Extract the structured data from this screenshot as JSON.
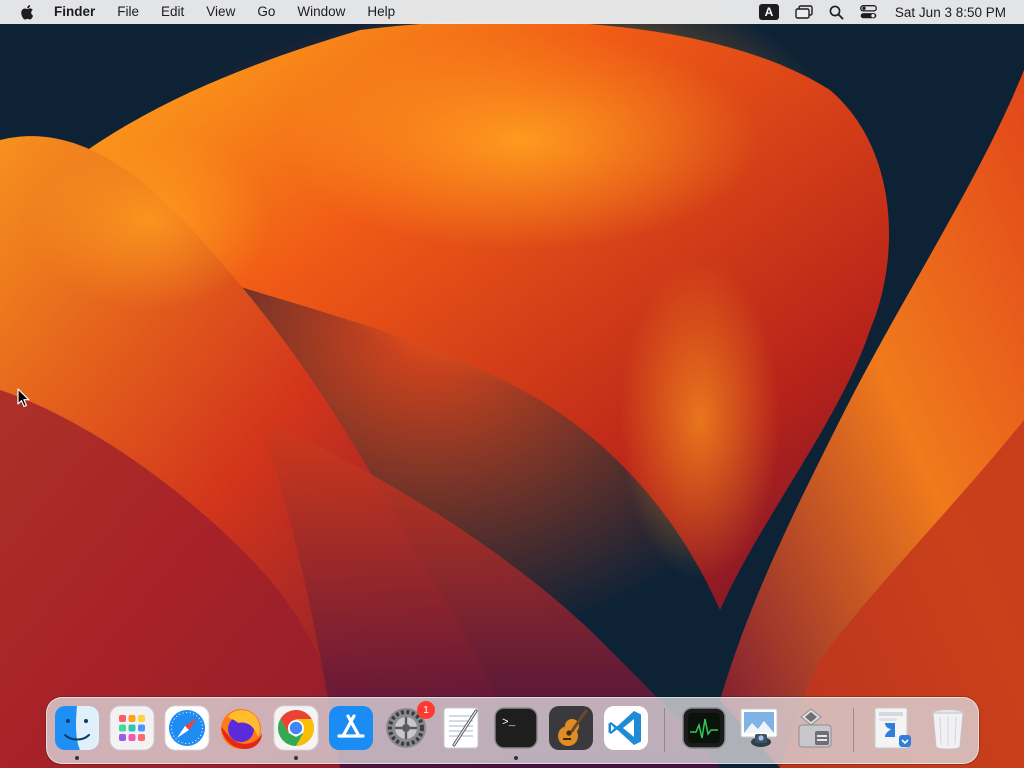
{
  "menubar": {
    "app_name": "Finder",
    "menus": [
      "File",
      "Edit",
      "View",
      "Go",
      "Window",
      "Help"
    ],
    "input_source": "A",
    "clock": "Sat Jun 3  8:50 PM"
  },
  "dock": {
    "apps": [
      {
        "name": "Finder",
        "icon": "finder-icon",
        "running": true
      },
      {
        "name": "Launchpad",
        "icon": "launchpad-icon",
        "running": false
      },
      {
        "name": "Safari",
        "icon": "safari-icon",
        "running": false
      },
      {
        "name": "Firefox",
        "icon": "firefox-icon",
        "running": false
      },
      {
        "name": "Google Chrome",
        "icon": "chrome-icon",
        "running": true
      },
      {
        "name": "App Store",
        "icon": "app-store-icon",
        "running": false
      },
      {
        "name": "System Settings",
        "icon": "system-settings-icon",
        "running": true,
        "badge": "1"
      },
      {
        "name": "TextEdit",
        "icon": "textedit-icon",
        "running": false
      },
      {
        "name": "Terminal",
        "icon": "terminal-icon",
        "running": true
      },
      {
        "name": "GarageBand",
        "icon": "garageband-icon",
        "running": false
      },
      {
        "name": "Visual Studio Code",
        "icon": "vscode-icon",
        "running": false
      },
      {
        "name": "Activity Monitor",
        "icon": "activity-monitor-icon",
        "running": false
      },
      {
        "name": "Preview",
        "icon": "preview-icon",
        "running": false
      },
      {
        "name": "Boot Camp Assistant",
        "icon": "bootcamp-icon",
        "running": false
      },
      {
        "name": "Downloads Stack",
        "icon": "downloads-stack-icon",
        "running": false
      },
      {
        "name": "Trash",
        "icon": "trash-icon",
        "running": false
      }
    ],
    "terminal_prompt": ">_"
  },
  "colors": {
    "menubar_bg": "#ececec",
    "wallpaper_dark": "#0e2236",
    "wallpaper_orange": "#f6901e",
    "wallpaper_red": "#e2461a",
    "badge_red": "#ff3b30"
  }
}
